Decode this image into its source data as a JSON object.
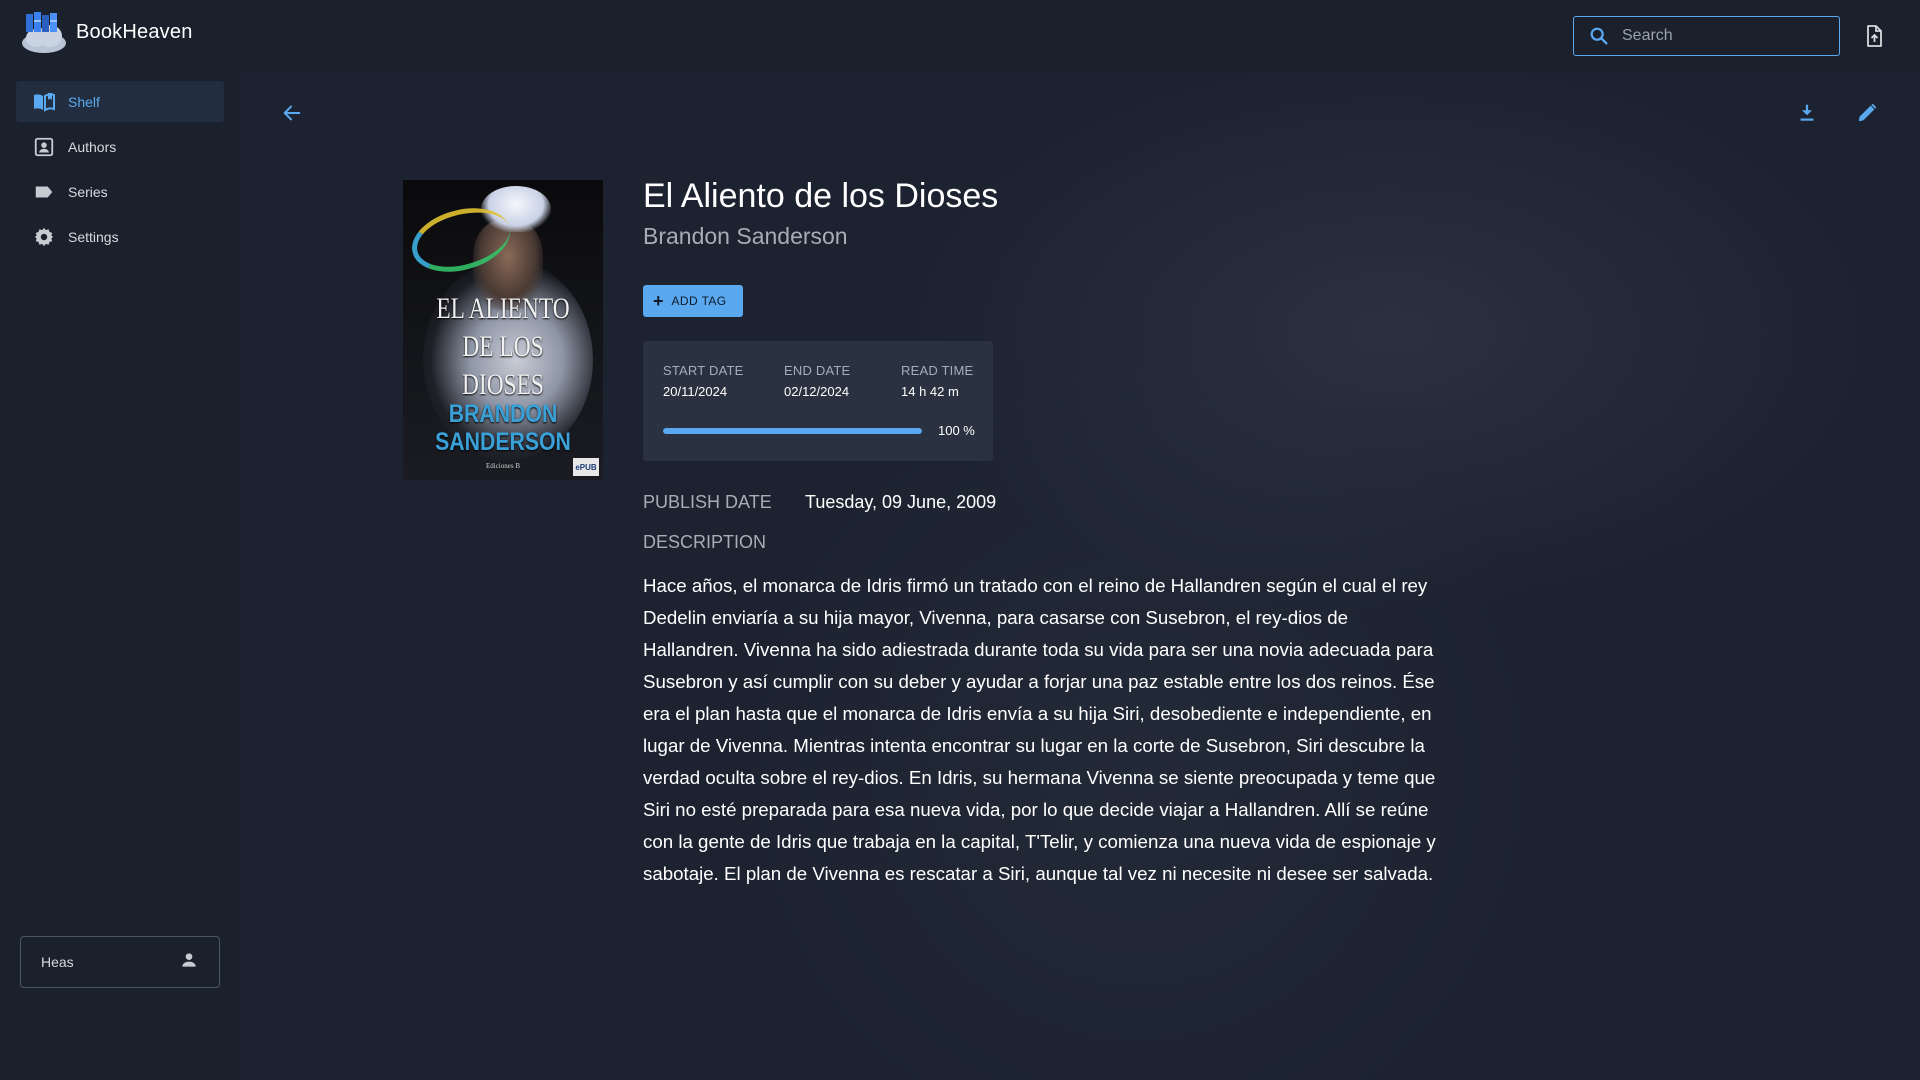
{
  "app": {
    "name": "BookHeaven",
    "accent_color": "#5aa9f0",
    "background_color": "#1a202c"
  },
  "header": {
    "search": {
      "placeholder": "Search",
      "value": ""
    },
    "upload_icon": "upload-file-icon"
  },
  "sidebar": {
    "items": [
      {
        "label": "Shelf",
        "icon": "book-open-icon",
        "active": true
      },
      {
        "label": "Authors",
        "icon": "contact-icon",
        "active": false
      },
      {
        "label": "Series",
        "icon": "label-icon",
        "active": false
      },
      {
        "label": "Settings",
        "icon": "gear-icon",
        "active": false
      }
    ],
    "user": {
      "name": "Heas",
      "icon": "person-icon"
    }
  },
  "toolbar": {
    "back_icon": "arrow-left-icon",
    "download_icon": "download-icon",
    "edit_icon": "pencil-icon"
  },
  "book": {
    "title": "El Aliento de los Dioses",
    "author": "Brandon Sanderson",
    "cover": {
      "title": "EL ALIENTO DE LOS DIOSES",
      "author": "BRANDON SANDERSON",
      "publisher": "Ediciones B",
      "badge": "ePUB"
    },
    "add_tag_label": "ADD TAG",
    "stats": {
      "start_date_label": "START DATE",
      "start_date": "20/11/2024",
      "end_date_label": "END DATE",
      "end_date": "02/12/2024",
      "read_time_label": "READ TIME",
      "read_time": "14 h 42 m",
      "progress": 1.0,
      "progress_text": "100 %"
    },
    "publish_date_label": "PUBLISH DATE",
    "publish_date": "Tuesday, 09 June, 2009",
    "description_label": "DESCRIPTION",
    "description": "Hace años, el monarca de Idris firmó un tratado con el reino de Hallandren según el cual el rey Dedelin enviaría a su hija mayor, Vivenna, para casarse con Susebron, el rey-dios de Hallandren. Vivenna ha sido adiestrada durante toda su vida para ser una novia adecuada para Susebron y así cumplir con su deber y ayudar a forjar una paz estable entre los dos reinos. Ése era el plan hasta que el monarca de Idris envía a su hija Siri, desobediente e independiente, en lugar de Vivenna. Mientras intenta encontrar su lugar en la corte de Susebron, Siri descubre la verdad oculta sobre el rey-dios. En Idris, su hermana Vivenna se siente preocupada y teme que Siri no esté preparada para esa nueva vida, por lo que decide viajar a Hallandren. Allí se reúne con la gente de Idris que trabaja en la capital, T'Telir, y comienza una nueva vida de espionaje y sabotaje. El plan de Vivenna es rescatar a Siri, aunque tal vez ni necesite ni desee ser salvada."
  }
}
